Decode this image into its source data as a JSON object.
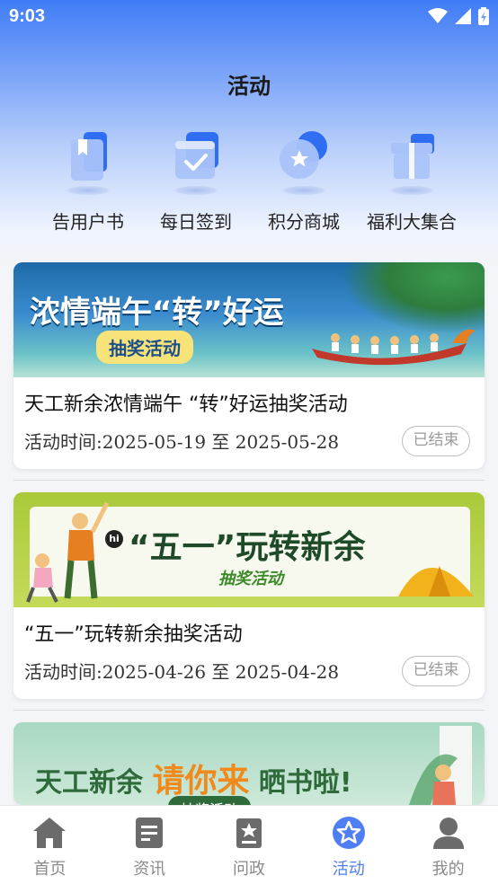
{
  "status_bar": {
    "time": "9:03"
  },
  "header": {
    "title": "活动"
  },
  "quick_links": [
    {
      "label": "告用户书",
      "icon": "book-icon"
    },
    {
      "label": "每日签到",
      "icon": "calendar-check-icon"
    },
    {
      "label": "积分商城",
      "icon": "star-coin-icon"
    },
    {
      "label": "福利大集合",
      "icon": "gift-icon"
    }
  ],
  "activities": [
    {
      "banner_headline": "浓情端午“转”好运",
      "banner_tag": "抽奖活动",
      "title": "天工新余浓情端午 “转”好运抽奖活动",
      "time": "活动时间:2025-05-19 至 2025-05-28",
      "status": "已结束"
    },
    {
      "banner_hi": "hi",
      "banner_headline": "“五一”玩转新余",
      "banner_tag": "抽奖活动",
      "title": "“五一”玩转新余抽奖活动",
      "time": "活动时间:2025-04-26 至 2025-04-28",
      "status": "已结束"
    },
    {
      "banner_headline_a": "天工新余",
      "banner_headline_b": "请你来",
      "banner_headline_c": "晒书啦!",
      "banner_tag": "抽奖活动"
    }
  ],
  "tabbar": [
    {
      "label": "首页",
      "icon": "home-icon",
      "active": false
    },
    {
      "label": "资讯",
      "icon": "news-icon",
      "active": false
    },
    {
      "label": "问政",
      "icon": "inquiry-icon",
      "active": false
    },
    {
      "label": "活动",
      "icon": "activity-star-icon",
      "active": true
    },
    {
      "label": "我的",
      "icon": "profile-icon",
      "active": false
    }
  ],
  "colors": {
    "accent": "#4f7df3",
    "inactive": "#8a8a8a"
  }
}
